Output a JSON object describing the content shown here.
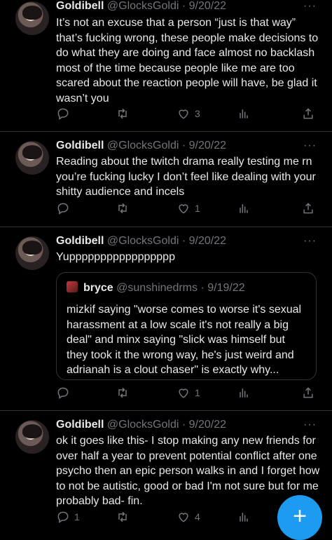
{
  "tweets": [
    {
      "name": "Goldibell",
      "handle": "@GlocksGoldi",
      "date": "· 9/20/22",
      "text": "It’s not an excuse that a person “just is that way” that’s fucking wrong, these people make decisions to do what they are doing and face almost no backlash most of the time because people like me are too scared about the reaction people will have, be glad it wasn’t you",
      "reply_count": "",
      "retweet_count": "",
      "like_count": "3"
    },
    {
      "name": "Goldibell",
      "handle": "@GlocksGoldi",
      "date": "· 9/20/22",
      "text": "Reading about the twitch drama really testing me rn you’re fucking lucky I don’t feel like dealing with your shitty audience and incels",
      "reply_count": "",
      "retweet_count": "",
      "like_count": "1"
    },
    {
      "name": "Goldibell",
      "handle": "@GlocksGoldi",
      "date": "· 9/20/22",
      "text": "Yuppppppppppppppppp",
      "quote": {
        "name": "bryce",
        "handle": "@sunshinedrms",
        "date": "· 9/19/22",
        "text": "mizkif saying \"worse comes to worse it's sexual harassment at a low scale it's not really a big deal\" and minx saying \"slick was himself but they took it the wrong way, he's just weird and adrianah is a clout chaser\" is exactly why..."
      },
      "reply_count": "",
      "retweet_count": "",
      "like_count": "1"
    },
    {
      "name": "Goldibell",
      "handle": "@GlocksGoldi",
      "date": "· 9/20/22",
      "text": "ok it goes like this- I stop making any new friends for over half a year to prevent potential conflict after one psycho then an epic person walks in and I forget how to not be autistic, good or bad I'm not sure but for me probably bad- fin.",
      "reply_count": "1",
      "retweet_count": "",
      "like_count": "4"
    }
  ],
  "more_label": "···",
  "compose_label": "+",
  "icons": [
    "reply-icon",
    "retweet-icon",
    "like-icon",
    "views-icon",
    "share-icon"
  ],
  "colors": {
    "background": "#000000",
    "text": "#e7e9ea",
    "muted": "#71767b",
    "accent": "#1d9bf0",
    "border": "#2f3336"
  }
}
